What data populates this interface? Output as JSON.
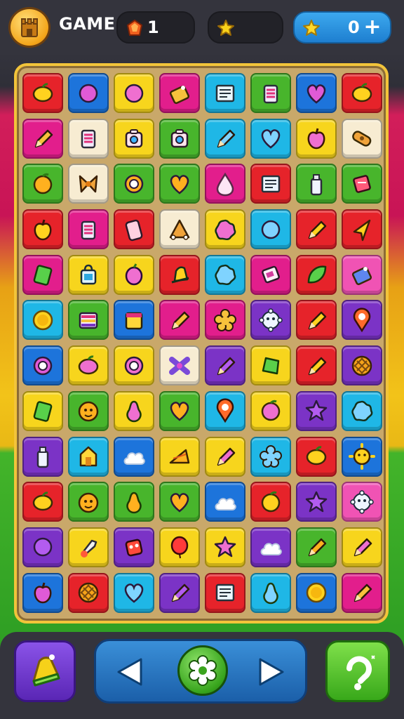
{
  "header": {
    "title": "GAME",
    "stats": [
      {
        "icon": "gem-icon",
        "value": "1"
      },
      {
        "icon": "star-icon",
        "value": ""
      },
      {
        "icon": "coin-icon",
        "value": "0"
      }
    ],
    "add_label": "+"
  },
  "colors": {
    "red": "#e6232a",
    "blue": "#1d74db",
    "yellow": "#f7d51d",
    "magenta": "#e21e8c",
    "cyan": "#1fb7e6",
    "green": "#48b52c",
    "purple": "#7b33c6",
    "pink": "#f053b4",
    "cream": "#f7ecd2"
  },
  "board": {
    "rows": [
      [
        {
          "c": "red",
          "icon": "lemon-icon"
        },
        {
          "c": "blue",
          "icon": "circle-icon"
        },
        {
          "c": "yellow",
          "icon": "circle-icon"
        },
        {
          "c": "magenta",
          "icon": "tag-icon"
        },
        {
          "c": "cyan",
          "icon": "note-icon"
        },
        {
          "c": "green",
          "icon": "battery-icon"
        },
        {
          "c": "blue",
          "icon": "heart-icon"
        },
        {
          "c": "red",
          "icon": "lemon-icon"
        }
      ],
      [
        {
          "c": "magenta",
          "icon": "pencil-icon"
        },
        {
          "c": "cream",
          "icon": "battery-icon"
        },
        {
          "c": "yellow",
          "icon": "camera-icon"
        },
        {
          "c": "green",
          "icon": "camera-icon"
        },
        {
          "c": "cyan",
          "icon": "pencil-icon"
        },
        {
          "c": "cyan",
          "icon": "heart-icon"
        },
        {
          "c": "yellow",
          "icon": "apple-icon"
        },
        {
          "c": "cream",
          "icon": "bandage-icon"
        }
      ],
      [
        {
          "c": "green",
          "icon": "orange-icon"
        },
        {
          "c": "cream",
          "icon": "bow-icon"
        },
        {
          "c": "green",
          "icon": "ring-icon"
        },
        {
          "c": "green",
          "icon": "heart-icon"
        },
        {
          "c": "magenta",
          "icon": "drop-icon"
        },
        {
          "c": "red",
          "icon": "note-icon"
        },
        {
          "c": "green",
          "icon": "bottle-icon"
        },
        {
          "c": "green",
          "icon": "box-icon"
        }
      ],
      [
        {
          "c": "red",
          "icon": "apple-icon"
        },
        {
          "c": "magenta",
          "icon": "battery-icon"
        },
        {
          "c": "red",
          "icon": "phone-icon"
        },
        {
          "c": "cream",
          "icon": "triangle-icon"
        },
        {
          "c": "yellow",
          "icon": "splat-icon"
        },
        {
          "c": "cyan",
          "icon": "circle-icon"
        },
        {
          "c": "red",
          "icon": "pencil-icon"
        },
        {
          "c": "red",
          "icon": "kite-icon"
        }
      ],
      [
        {
          "c": "magenta",
          "icon": "tablet-icon"
        },
        {
          "c": "yellow",
          "icon": "bag-icon"
        },
        {
          "c": "yellow",
          "icon": "plum-icon"
        },
        {
          "c": "red",
          "icon": "bell-icon"
        },
        {
          "c": "cyan",
          "icon": "splat-icon"
        },
        {
          "c": "magenta",
          "icon": "card-icon"
        },
        {
          "c": "red",
          "icon": "leaf-icon"
        },
        {
          "c": "pink",
          "icon": "tag-icon"
        }
      ],
      [
        {
          "c": "cyan",
          "icon": "coin-icon"
        },
        {
          "c": "green",
          "icon": "stripes-icon"
        },
        {
          "c": "blue",
          "icon": "calendar-icon"
        },
        {
          "c": "magenta",
          "icon": "pencil-icon"
        },
        {
          "c": "magenta",
          "icon": "flower-icon"
        },
        {
          "c": "purple",
          "icon": "gear-icon"
        },
        {
          "c": "red",
          "icon": "pencil-icon"
        },
        {
          "c": "purple",
          "icon": "pin-icon"
        }
      ],
      [
        {
          "c": "blue",
          "icon": "ring-icon"
        },
        {
          "c": "yellow",
          "icon": "lemon-icon"
        },
        {
          "c": "yellow",
          "icon": "ring-icon"
        },
        {
          "c": "cream",
          "icon": "cross-icon"
        },
        {
          "c": "purple",
          "icon": "pencil-icon"
        },
        {
          "c": "yellow",
          "icon": "gem-icon"
        },
        {
          "c": "red",
          "icon": "pencil-icon"
        },
        {
          "c": "purple",
          "icon": "waffle-icon"
        }
      ],
      [
        {
          "c": "yellow",
          "icon": "tablet-icon"
        },
        {
          "c": "green",
          "icon": "face-icon"
        },
        {
          "c": "yellow",
          "icon": "pear-icon"
        },
        {
          "c": "green",
          "icon": "heart-icon"
        },
        {
          "c": "cyan",
          "icon": "pin-icon"
        },
        {
          "c": "yellow",
          "icon": "orange-icon"
        },
        {
          "c": "purple",
          "icon": "star-icon"
        },
        {
          "c": "cyan",
          "icon": "splat-icon"
        }
      ],
      [
        {
          "c": "purple",
          "icon": "bottle-icon"
        },
        {
          "c": "cyan",
          "icon": "house-icon"
        },
        {
          "c": "blue",
          "icon": "cloud-icon"
        },
        {
          "c": "yellow",
          "icon": "cheese-icon"
        },
        {
          "c": "yellow",
          "icon": "pencil-icon"
        },
        {
          "c": "cyan",
          "icon": "flower-icon"
        },
        {
          "c": "red",
          "icon": "lemon-icon"
        },
        {
          "c": "blue",
          "icon": "sun-icon"
        }
      ],
      [
        {
          "c": "red",
          "icon": "lemon-icon"
        },
        {
          "c": "green",
          "icon": "face-icon"
        },
        {
          "c": "green",
          "icon": "pear-icon"
        },
        {
          "c": "green",
          "icon": "heart-icon"
        },
        {
          "c": "blue",
          "icon": "cloud-icon"
        },
        {
          "c": "red",
          "icon": "orange-icon"
        },
        {
          "c": "purple",
          "icon": "star-icon"
        },
        {
          "c": "pink",
          "icon": "gear-icon"
        }
      ],
      [
        {
          "c": "purple",
          "icon": "circle-icon"
        },
        {
          "c": "yellow",
          "icon": "rocket-icon"
        },
        {
          "c": "purple",
          "icon": "robot-icon"
        },
        {
          "c": "yellow",
          "icon": "balloon-icon"
        },
        {
          "c": "yellow",
          "icon": "star-icon"
        },
        {
          "c": "purple",
          "icon": "cloud-icon"
        },
        {
          "c": "green",
          "icon": "pencil-icon"
        },
        {
          "c": "yellow",
          "icon": "pencil-icon"
        }
      ],
      [
        {
          "c": "blue",
          "icon": "apple-icon"
        },
        {
          "c": "red",
          "icon": "waffle-icon"
        },
        {
          "c": "cyan",
          "icon": "heart-icon"
        },
        {
          "c": "purple",
          "icon": "pencil-icon"
        },
        {
          "c": "red",
          "icon": "note-icon"
        },
        {
          "c": "cyan",
          "icon": "pear-icon"
        },
        {
          "c": "blue",
          "icon": "coin-icon"
        },
        {
          "c": "magenta",
          "icon": "pencil-icon"
        }
      ]
    ]
  },
  "controls": {
    "hint": {
      "icon": "bell-icon"
    },
    "prev": {
      "icon": "arrow-left-icon"
    },
    "settings": {
      "icon": "gear-icon"
    },
    "next": {
      "icon": "arrow-right-icon"
    },
    "undo": {
      "icon": "undo-icon"
    }
  }
}
